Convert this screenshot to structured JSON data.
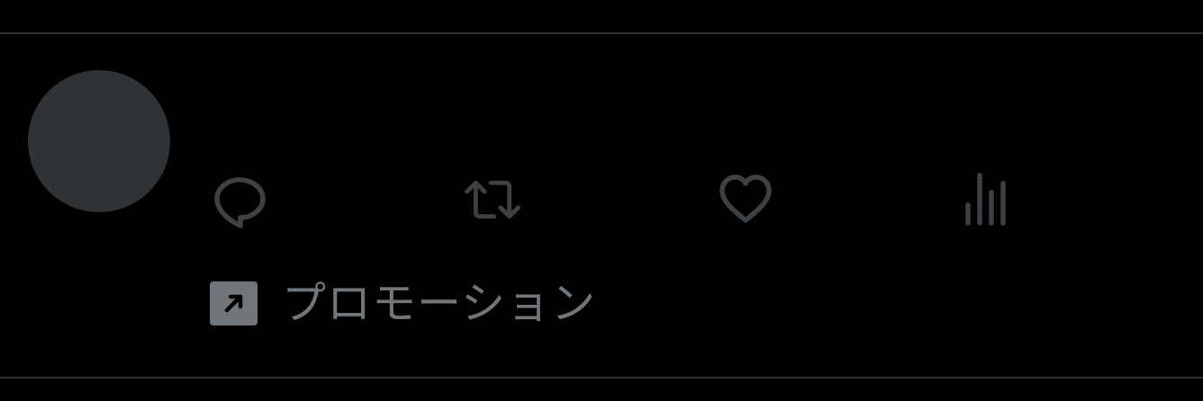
{
  "colors": {
    "background": "#000000",
    "divider": "#2f3336",
    "avatar_placeholder": "#2f3336",
    "action_icon": "#3e4144",
    "promo_text": "#71767b",
    "promo_badge": "#71767b"
  },
  "tweet": {
    "actions": [
      {
        "icon": "reply-icon"
      },
      {
        "icon": "retweet-icon"
      },
      {
        "icon": "like-heart-icon"
      },
      {
        "icon": "views-analytics-icon"
      }
    ],
    "promoted": {
      "icon": "promoted-arrow-icon",
      "label": "プロモーション"
    }
  }
}
